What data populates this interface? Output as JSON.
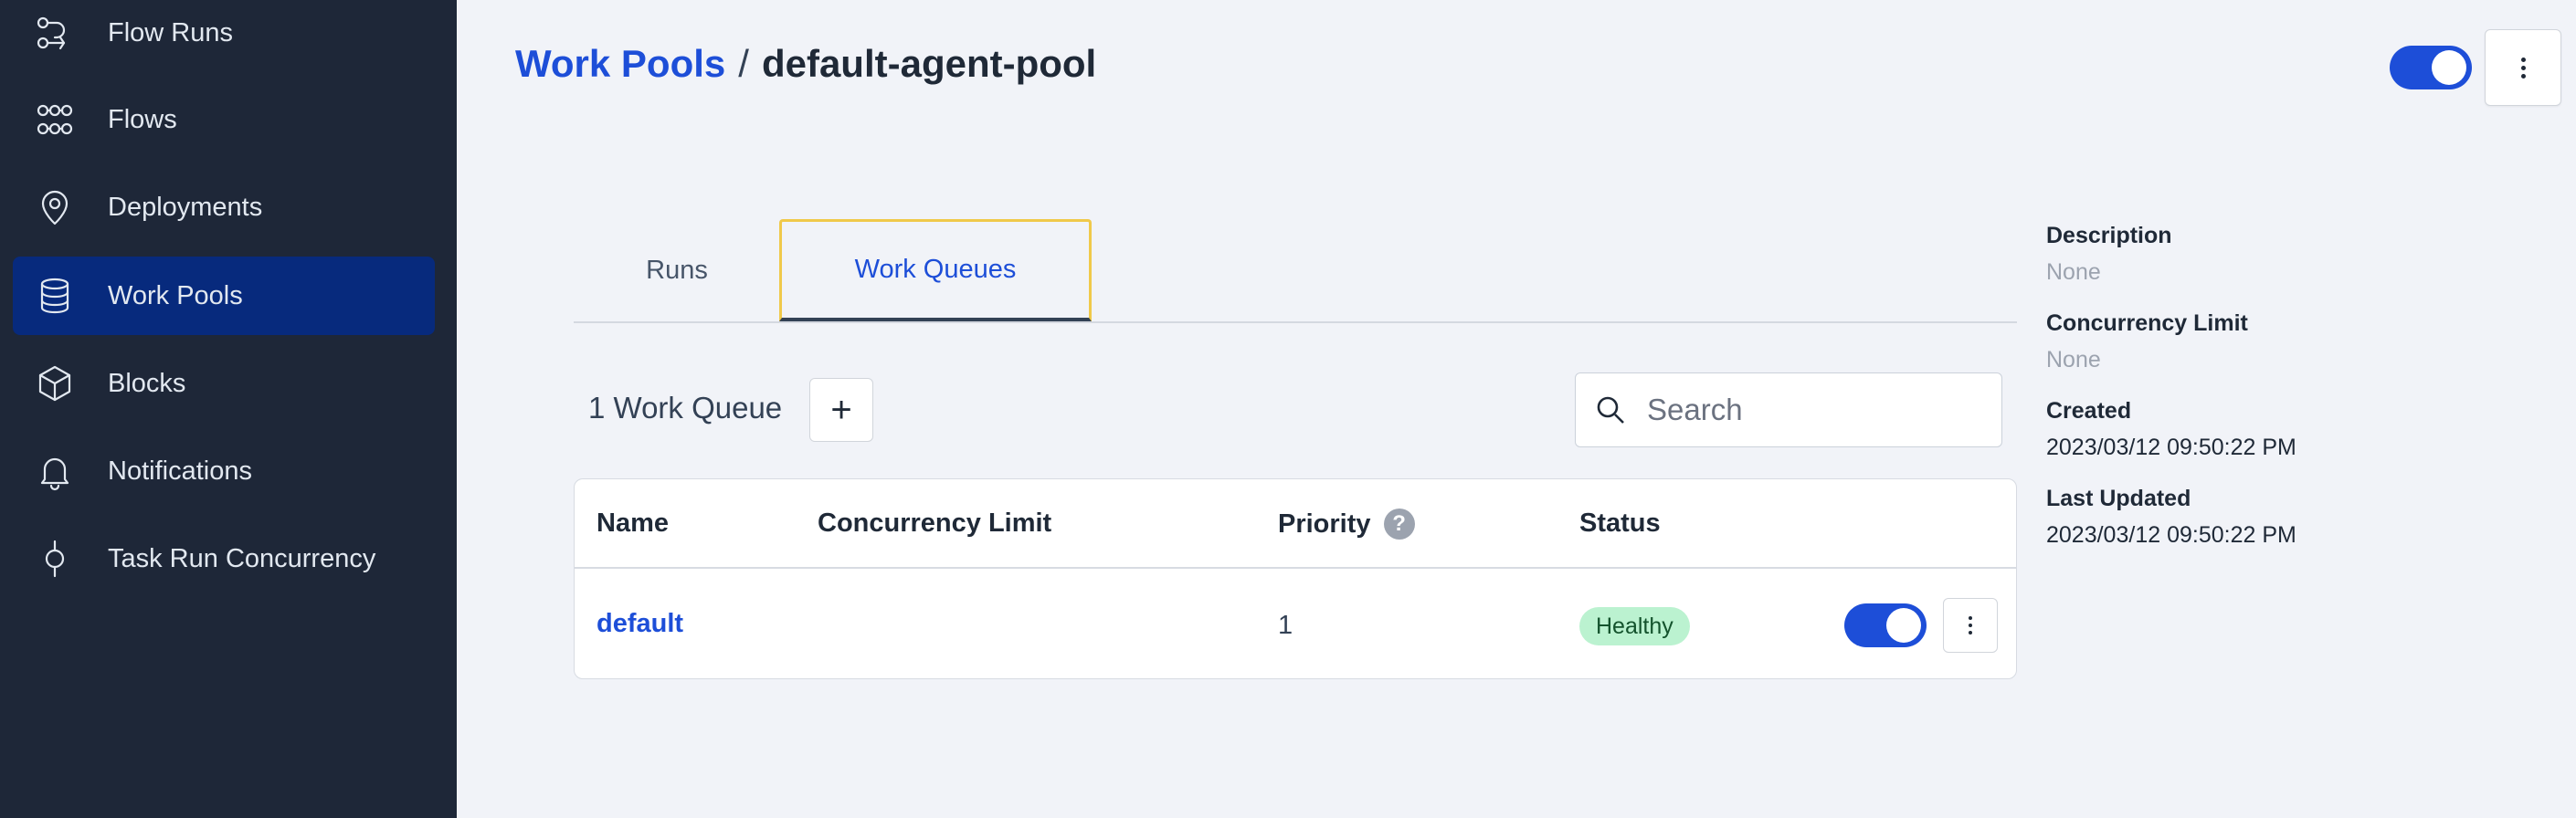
{
  "sidebar": {
    "items": [
      {
        "label": "Flow Runs",
        "icon": "flow-runs-icon"
      },
      {
        "label": "Flows",
        "icon": "flows-icon"
      },
      {
        "label": "Deployments",
        "icon": "location-pin-icon"
      },
      {
        "label": "Work Pools",
        "icon": "database-icon",
        "active": true
      },
      {
        "label": "Blocks",
        "icon": "cube-icon"
      },
      {
        "label": "Notifications",
        "icon": "bell-icon"
      },
      {
        "label": "Task Run Concurrency",
        "icon": "concurrency-icon"
      }
    ]
  },
  "header": {
    "breadcrumb_link": "Work Pools",
    "separator": "/",
    "current": "default-agent-pool",
    "pool_enabled": true
  },
  "tabs": [
    {
      "label": "Runs",
      "active": false
    },
    {
      "label": "Work Queues",
      "active": true
    }
  ],
  "toolbar": {
    "count_label": "1 Work Queue",
    "add_label": "+",
    "search_placeholder": "Search"
  },
  "table": {
    "columns": [
      "Name",
      "Concurrency Limit",
      "Priority",
      "Status"
    ],
    "rows": [
      {
        "name": "default",
        "concurrency_limit": "",
        "priority": "1",
        "status": "Healthy",
        "enabled": true
      }
    ]
  },
  "details": [
    {
      "label": "Description",
      "value": "None"
    },
    {
      "label": "Concurrency Limit",
      "value": "None"
    },
    {
      "label": "Created",
      "value": "2023/03/12 09:50:22 PM"
    },
    {
      "label": "Last Updated",
      "value": "2023/03/12 09:50:22 PM"
    }
  ],
  "colors": {
    "sidebar_bg": "#1e2738",
    "active_nav_bg": "#072a7d",
    "accent": "#1d4ed8",
    "healthy_badge_bg": "#bbf2d0",
    "page_bg": "#f1f3f8"
  }
}
